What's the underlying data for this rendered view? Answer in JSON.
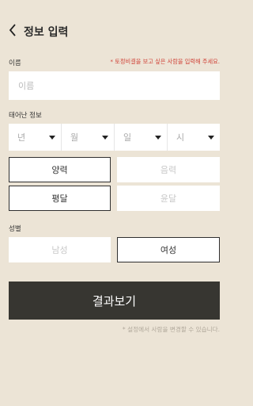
{
  "header": {
    "title": "정보 입력"
  },
  "name": {
    "label": "이름",
    "hint": "* 토정비결을 보고 싶은 사람을 입력해 주세요.",
    "placeholder": "이름"
  },
  "birth": {
    "label": "태어난 정보",
    "selects": [
      {
        "label": "년"
      },
      {
        "label": "월"
      },
      {
        "label": "일"
      },
      {
        "label": "시"
      }
    ],
    "calendar": {
      "solar": "양력",
      "lunar": "음력",
      "selected": "양력"
    },
    "month_type": {
      "normal": "평달",
      "leap": "윤달",
      "selected": "평달"
    }
  },
  "gender": {
    "label": "성별",
    "male": "남성",
    "female": "여성",
    "selected": "여성"
  },
  "submit_label": "결과보기",
  "footnote": "* 설정에서 사람을 변경할 수 있습니다."
}
